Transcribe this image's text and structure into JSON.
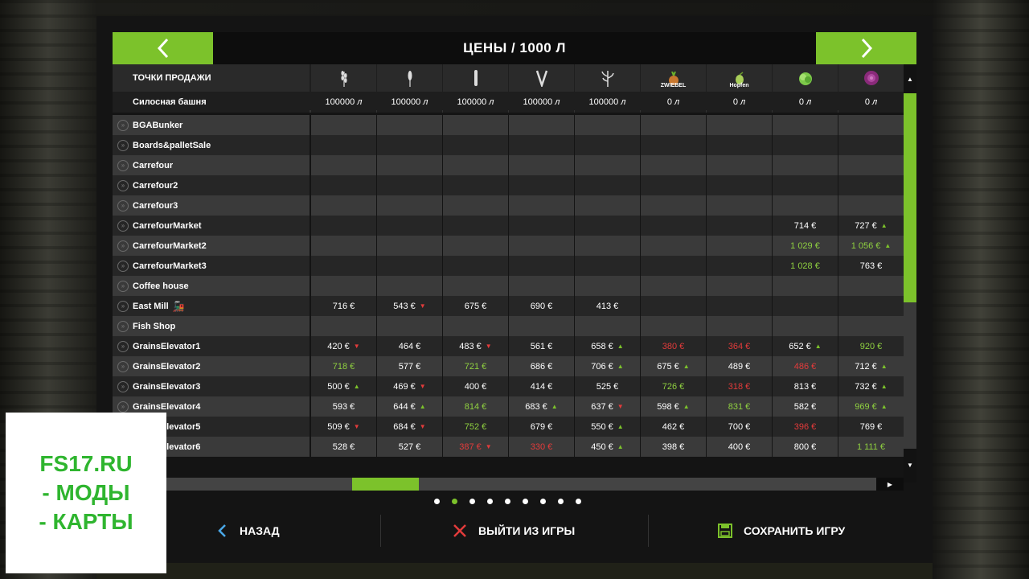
{
  "header": {
    "title": "ЦЕНЫ / 1000 Л"
  },
  "table": {
    "first_col_header": "ТОЧКИ ПРОДАЖИ",
    "storage_label": "Силосная башня",
    "columns": [
      {
        "icon": "wheat-icon",
        "label": "",
        "storage": "100000",
        "unit": "л"
      },
      {
        "icon": "barley-icon",
        "label": "",
        "storage": "100000",
        "unit": "л"
      },
      {
        "icon": "rapeseed-icon",
        "label": "",
        "storage": "100000",
        "unit": "л"
      },
      {
        "icon": "sunflower-icon",
        "label": "",
        "storage": "100000",
        "unit": "л"
      },
      {
        "icon": "maize-icon",
        "label": "",
        "storage": "100000",
        "unit": "л"
      },
      {
        "icon": "onion-icon",
        "label": "ZWIEBEL",
        "storage": "0",
        "unit": "л"
      },
      {
        "icon": "hops-icon",
        "label": "Hopfen",
        "storage": "0",
        "unit": "л"
      },
      {
        "icon": "lettuce-icon",
        "label": "",
        "storage": "0",
        "unit": "л"
      },
      {
        "icon": "red-cabbage-icon",
        "label": "",
        "storage": "0",
        "unit": "л"
      }
    ],
    "rows": [
      {
        "name": "BGABunker",
        "train": false,
        "cells": [
          null,
          null,
          null,
          null,
          null,
          null,
          null,
          null,
          null
        ]
      },
      {
        "name": "Boards&palletSale",
        "train": false,
        "cells": [
          null,
          null,
          null,
          null,
          null,
          null,
          null,
          null,
          null
        ]
      },
      {
        "name": "Carrefour",
        "train": false,
        "cells": [
          null,
          null,
          null,
          null,
          null,
          null,
          null,
          null,
          null
        ]
      },
      {
        "name": "Carrefour2",
        "train": false,
        "cells": [
          null,
          null,
          null,
          null,
          null,
          null,
          null,
          null,
          null
        ]
      },
      {
        "name": "Carrefour3",
        "train": false,
        "cells": [
          null,
          null,
          null,
          null,
          null,
          null,
          null,
          null,
          null
        ]
      },
      {
        "name": "CarrefourMarket",
        "train": false,
        "cells": [
          null,
          null,
          null,
          null,
          null,
          null,
          null,
          {
            "v": "714 €",
            "c": "white",
            "t": ""
          },
          {
            "v": "727 €",
            "c": "white",
            "t": "up"
          }
        ]
      },
      {
        "name": "CarrefourMarket2",
        "train": false,
        "cells": [
          null,
          null,
          null,
          null,
          null,
          null,
          null,
          {
            "v": "1 029 €",
            "c": "green",
            "t": ""
          },
          {
            "v": "1 056 €",
            "c": "green",
            "t": "up"
          }
        ]
      },
      {
        "name": "CarrefourMarket3",
        "train": false,
        "cells": [
          null,
          null,
          null,
          null,
          null,
          null,
          null,
          {
            "v": "1 028 €",
            "c": "green",
            "t": ""
          },
          {
            "v": "763 €",
            "c": "white",
            "t": ""
          }
        ]
      },
      {
        "name": "Coffee house",
        "train": false,
        "cells": [
          null,
          null,
          null,
          null,
          null,
          null,
          null,
          null,
          null
        ]
      },
      {
        "name": "East Mill",
        "train": true,
        "cells": [
          {
            "v": "716 €",
            "c": "white",
            "t": ""
          },
          {
            "v": "543 €",
            "c": "white",
            "t": "down"
          },
          {
            "v": "675 €",
            "c": "white",
            "t": ""
          },
          {
            "v": "690 €",
            "c": "white",
            "t": ""
          },
          {
            "v": "413 €",
            "c": "white",
            "t": ""
          },
          null,
          null,
          null,
          null
        ]
      },
      {
        "name": "Fish Shop",
        "train": false,
        "cells": [
          null,
          null,
          null,
          null,
          null,
          null,
          null,
          null,
          null
        ]
      },
      {
        "name": "GrainsElevator1",
        "train": false,
        "cells": [
          {
            "v": "420 €",
            "c": "white",
            "t": "down"
          },
          {
            "v": "464 €",
            "c": "white",
            "t": ""
          },
          {
            "v": "483 €",
            "c": "white",
            "t": "down"
          },
          {
            "v": "561 €",
            "c": "white",
            "t": ""
          },
          {
            "v": "658 €",
            "c": "white",
            "t": "up"
          },
          {
            "v": "380 €",
            "c": "red",
            "t": ""
          },
          {
            "v": "364 €",
            "c": "red",
            "t": ""
          },
          {
            "v": "652 €",
            "c": "white",
            "t": "up"
          },
          {
            "v": "920 €",
            "c": "green",
            "t": ""
          }
        ]
      },
      {
        "name": "GrainsElevator2",
        "train": false,
        "cells": [
          {
            "v": "718 €",
            "c": "green",
            "t": ""
          },
          {
            "v": "577 €",
            "c": "white",
            "t": ""
          },
          {
            "v": "721 €",
            "c": "green",
            "t": ""
          },
          {
            "v": "686 €",
            "c": "white",
            "t": ""
          },
          {
            "v": "706 €",
            "c": "white",
            "t": "up"
          },
          {
            "v": "675 €",
            "c": "white",
            "t": "up"
          },
          {
            "v": "489 €",
            "c": "white",
            "t": ""
          },
          {
            "v": "486 €",
            "c": "red",
            "t": ""
          },
          {
            "v": "712 €",
            "c": "white",
            "t": "up"
          }
        ]
      },
      {
        "name": "GrainsElevator3",
        "train": false,
        "cells": [
          {
            "v": "500 €",
            "c": "white",
            "t": "up"
          },
          {
            "v": "469 €",
            "c": "white",
            "t": "down"
          },
          {
            "v": "400 €",
            "c": "white",
            "t": ""
          },
          {
            "v": "414 €",
            "c": "white",
            "t": ""
          },
          {
            "v": "525 €",
            "c": "white",
            "t": ""
          },
          {
            "v": "726 €",
            "c": "green",
            "t": ""
          },
          {
            "v": "318 €",
            "c": "red",
            "t": ""
          },
          {
            "v": "813 €",
            "c": "white",
            "t": ""
          },
          {
            "v": "732 €",
            "c": "white",
            "t": "up"
          }
        ]
      },
      {
        "name": "GrainsElevator4",
        "train": false,
        "cells": [
          {
            "v": "593 €",
            "c": "white",
            "t": ""
          },
          {
            "v": "644 €",
            "c": "white",
            "t": "up"
          },
          {
            "v": "814 €",
            "c": "green",
            "t": ""
          },
          {
            "v": "683 €",
            "c": "white",
            "t": "up"
          },
          {
            "v": "637 €",
            "c": "white",
            "t": "down"
          },
          {
            "v": "598 €",
            "c": "white",
            "t": "up"
          },
          {
            "v": "831 €",
            "c": "green",
            "t": ""
          },
          {
            "v": "582 €",
            "c": "white",
            "t": ""
          },
          {
            "v": "969 €",
            "c": "green",
            "t": "up"
          }
        ]
      },
      {
        "name": "GrainsElevator5",
        "train": false,
        "cells": [
          {
            "v": "509 €",
            "c": "white",
            "t": "down"
          },
          {
            "v": "684 €",
            "c": "white",
            "t": "down"
          },
          {
            "v": "752 €",
            "c": "green",
            "t": ""
          },
          {
            "v": "679 €",
            "c": "white",
            "t": ""
          },
          {
            "v": "550 €",
            "c": "white",
            "t": "up"
          },
          {
            "v": "462 €",
            "c": "white",
            "t": ""
          },
          {
            "v": "700 €",
            "c": "white",
            "t": ""
          },
          {
            "v": "396 €",
            "c": "red",
            "t": ""
          },
          {
            "v": "769 €",
            "c": "white",
            "t": ""
          }
        ]
      },
      {
        "name": "GrainsElevator6",
        "train": false,
        "cells": [
          {
            "v": "528 €",
            "c": "white",
            "t": ""
          },
          {
            "v": "527 €",
            "c": "white",
            "t": ""
          },
          {
            "v": "387 €",
            "c": "red",
            "t": "down"
          },
          {
            "v": "330 €",
            "c": "red",
            "t": ""
          },
          {
            "v": "450 €",
            "c": "white",
            "t": "up"
          },
          {
            "v": "398 €",
            "c": "white",
            "t": ""
          },
          {
            "v": "400 €",
            "c": "white",
            "t": ""
          },
          {
            "v": "800 €",
            "c": "white",
            "t": ""
          },
          {
            "v": "1 111 €",
            "c": "green",
            "t": ""
          }
        ]
      }
    ]
  },
  "pagination": {
    "count": 9,
    "active": 1
  },
  "footer": {
    "back_label": "НАЗАД",
    "quit_label": "ВЫЙТИ ИЗ ИГРЫ",
    "save_label": "СОХРАНИТЬ ИГРУ"
  },
  "watermark": {
    "line1": "FS17.RU",
    "line2": "- МОДЫ",
    "line3": "- КАРТЫ"
  },
  "colors": {
    "accent": "#7cc22b",
    "up": "#7cc22b",
    "down": "#e33b3b",
    "price_high": "#8fd040",
    "price_low": "#e33b3b"
  }
}
